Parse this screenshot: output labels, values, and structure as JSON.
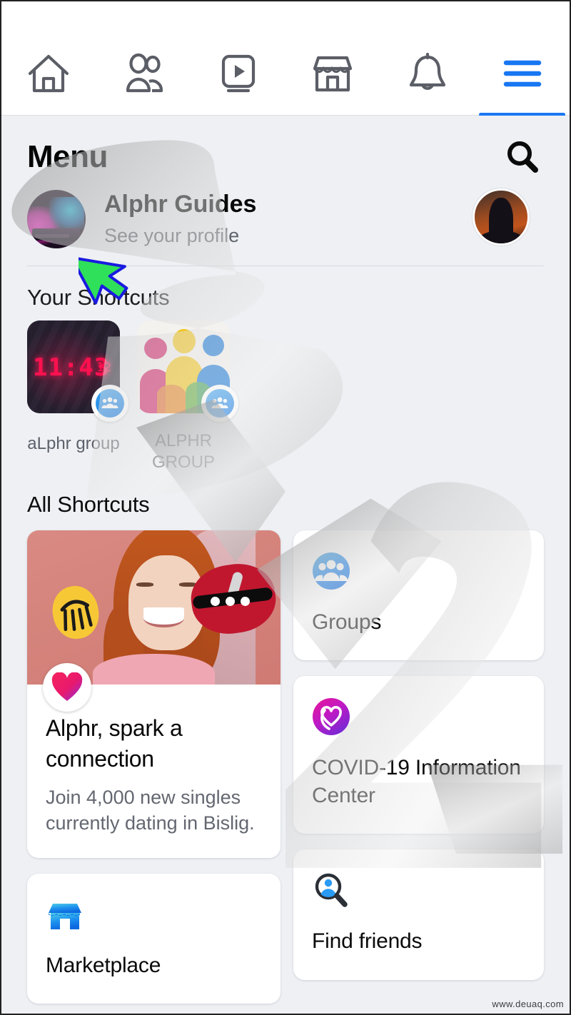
{
  "topnav": {
    "items": [
      {
        "name": "home-icon",
        "label": "Home",
        "active": false
      },
      {
        "name": "friends-icon",
        "label": "Friends",
        "active": false
      },
      {
        "name": "video-icon",
        "label": "Watch",
        "active": false
      },
      {
        "name": "marketplace-icon",
        "label": "Marketplace",
        "active": false
      },
      {
        "name": "notifications-icon",
        "label": "Notifications",
        "active": false
      },
      {
        "name": "hamburger-menu-icon",
        "label": "Menu",
        "active": true
      }
    ],
    "active_color": "#1877f2"
  },
  "header": {
    "title": "Menu",
    "search_icon": "search-icon"
  },
  "profile": {
    "name": "Alphr Guides",
    "subtitle": "See your profile",
    "avatar": "profile-avatar",
    "secondary_avatar": "account-avatar"
  },
  "your_shortcuts": {
    "title": "Your Shortcuts",
    "items": [
      {
        "label": "aLphr group",
        "badge": "group-badge-icon",
        "thumb": "clock-photo",
        "clock_time": "11:43",
        "clock_secondary": "12"
      },
      {
        "label": "ALPHR GROUP",
        "badge": "group-badge-icon",
        "thumb": "people-illustration"
      }
    ]
  },
  "all_shortcuts": {
    "title": "All Shortcuts",
    "dating_card": {
      "badge_icon": "dating-heart-icon",
      "title": "Alphr, spark a connection",
      "subtitle": "Join 4,000 new singles currently dating in Bislig."
    },
    "cards": [
      {
        "label": "Groups",
        "icon": "groups-icon"
      },
      {
        "label": "COVID-19 Information Center",
        "icon": "covid-heart-icon"
      },
      {
        "label": "Find friends",
        "icon": "find-friends-icon"
      },
      {
        "label": "Marketplace",
        "icon": "marketplace-store-icon"
      }
    ]
  },
  "watermark": {
    "url": "www.deuaq.com"
  },
  "colors": {
    "background": "#eef0f4",
    "card": "#ffffff",
    "accent_blue": "#1877f2",
    "text_primary": "#050505",
    "text_secondary": "#60646c"
  }
}
